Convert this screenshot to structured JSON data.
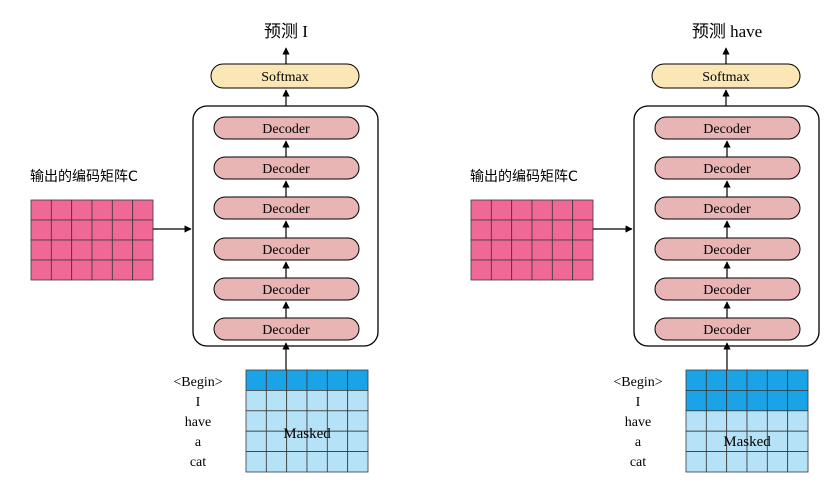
{
  "colors": {
    "decoder_fill": "#e8b4b4",
    "softmax_fill": "#fbe6b6",
    "matrix_c_fill": "#f06896",
    "masked_visible": "#1aa3e6",
    "masked_hidden": "#b6e2f7",
    "grid_line": "#3a3a3a"
  },
  "panels": [
    {
      "prediction_label": "预测 I",
      "softmax_label": "Softmax",
      "decoder_labels": [
        "Decoder",
        "Decoder",
        "Decoder",
        "Decoder",
        "Decoder",
        "Decoder"
      ],
      "encoder_matrix_label": "输出的编码矩阵C",
      "input_tokens": [
        "<Begin>",
        "I",
        "have",
        "a",
        "cat"
      ],
      "masked_label": "Masked",
      "visible_rows": 1
    },
    {
      "prediction_label": "预测 have",
      "softmax_label": "Softmax",
      "decoder_labels": [
        "Decoder",
        "Decoder",
        "Decoder",
        "Decoder",
        "Decoder",
        "Decoder"
      ],
      "encoder_matrix_label": "输出的编码矩阵C",
      "input_tokens": [
        "<Begin>",
        "I",
        "have",
        "a",
        "cat"
      ],
      "masked_label": "Masked",
      "visible_rows": 2
    }
  ]
}
